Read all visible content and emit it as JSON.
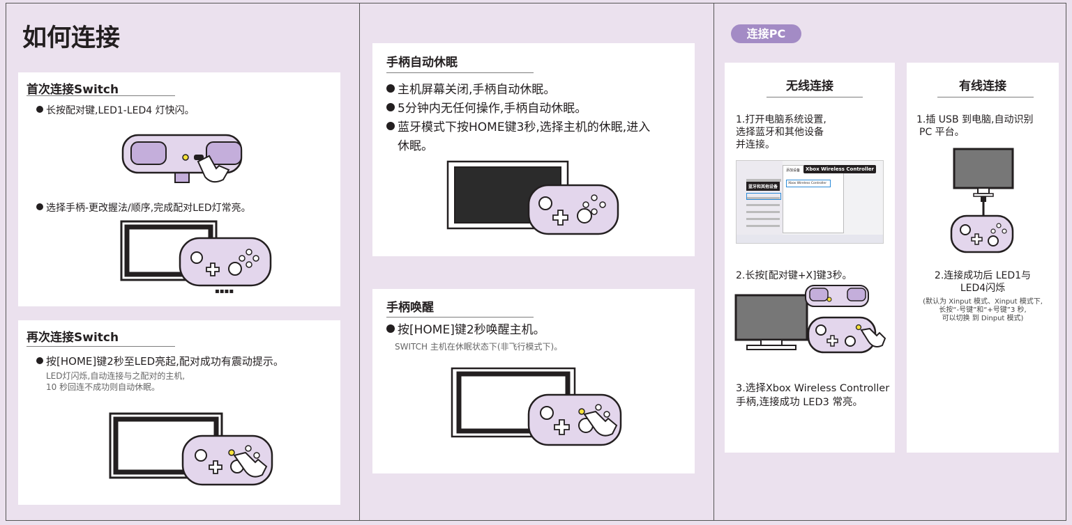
{
  "main_title": "如何连接",
  "section1": {
    "heading": "首次连接Switch",
    "step1": "长按配对键,LED1-LED4 灯快闪。",
    "step2": "选择手柄-更改握法/顺序,完成配对LED灯常亮。",
    "console_dots": "▪▪▪▪"
  },
  "section2": {
    "heading": "再次连接Switch",
    "step1": "按[HOME]键2秒至LED亮起,配对成功有震动提示。",
    "note_line1": "LED灯闪烁,自动连接与之配对的主机,",
    "note_line2": "10 秒回连不成功则自动休眠。"
  },
  "sleep": {
    "heading": "手柄自动休眠",
    "item1": "主机屏幕关闭,手柄自动休眠。",
    "item2": "5分钟内无任何操作,手柄自动休眠。",
    "item3_line1": "蓝牙模式下按HOME键3秒,选择主机的休眠,进入",
    "item3_line2": "休眠。"
  },
  "wake": {
    "heading": "手柄唤醒",
    "item1": "按[HOME]键2秒唤醒主机。",
    "note": "SWITCH 主机在休眠状态下(非飞行模式下)。"
  },
  "pc": {
    "badge": "连接PC",
    "wireless": {
      "heading": "无线连接",
      "step1_line1": "1.打开电脑系统设置,",
      "step1_line2": "选择蓝牙和其他设备",
      "step1_line3": "并连接。",
      "step2": "2.长按[配对键+X]键3秒。",
      "step3_line1": "3.选择Xbox Wireless Controller",
      "step3_line2": "手柄,连接成功 LED3 常亮。",
      "screen_popup_title": "Xbox Wireless Controller",
      "screen_bt_label": "蓝牙和其他设备",
      "screen_add_device": "添加设备",
      "screen_list_item": "Xbox Wireless Controller"
    },
    "wired": {
      "heading": "有线连接",
      "step1_line1": "1.插 USB 到电脑,自动识别",
      "step1_line2": "PC 平台。",
      "step2_line1": "2.连接成功后 LED1与",
      "step2_line2": "LED4闪烁",
      "note_line1": "(默认为 Xinput 模式、Xinput 模式下,",
      "note_line2": "长按“-号键”和“+号键”3 秒,",
      "note_line3": "可以切换 到 Dinput 模式)"
    }
  },
  "colors": {
    "background": "#ebe1ee",
    "controller_fill": "#e3d6ec",
    "controller_dark": "#c4aedb",
    "badge": "#a38bc5",
    "led_yellow": "#f5e13a"
  }
}
